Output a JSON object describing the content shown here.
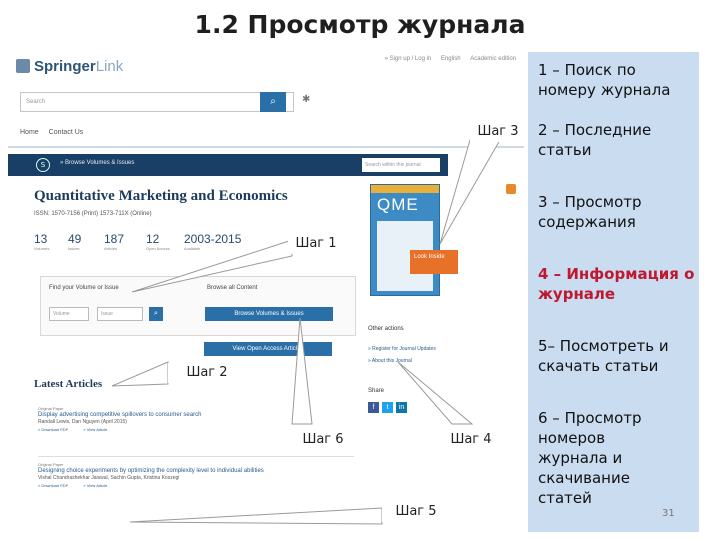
{
  "slide_title": "1.2 Просмотр журнала",
  "springer": {
    "logo_main": "Springer",
    "logo_link": "Link",
    "topnav": [
      "» Sign up / Log in",
      "English",
      "Academic edition"
    ],
    "search_placeholder": "Search",
    "search_icon": "magnifier-icon",
    "breadcrumbs": [
      "Home",
      "Contact Us"
    ],
    "browse_bar_text": "» Browse Volumes & Issues",
    "bar_search_placeholder": "Search within this journal",
    "journal_title": "Quantitative Marketing and Economics",
    "issn": "ISSN: 1570-7156 (Print) 1573-711X (Online)",
    "stats": [
      {
        "num": "13",
        "label": "Volumes"
      },
      {
        "num": "49",
        "label": "Issues"
      },
      {
        "num": "187",
        "label": "Articles"
      },
      {
        "num": "12",
        "label": "Open Access"
      },
      {
        "num": "2003-2015",
        "label": "Available"
      }
    ],
    "cover_text": "QME",
    "look_inside": "Look Inside",
    "find_label": "Find your Volume or Issue",
    "browse_label": "Browse all Content",
    "volume_placeholder": "Volume",
    "issue_placeholder": "Issue",
    "browse_button": "Browse Volumes & Issues",
    "open_access_button": "View Open Access Articles",
    "other_actions": "Other actions",
    "other_links": [
      "» Register for Journal Updates",
      "» About this Journal"
    ],
    "share": "Share",
    "latest_articles": "Latest Articles",
    "articles": [
      {
        "type": "Original Paper",
        "title": "Display advertising competitive spillovers to consumer search",
        "authors": "Randall Lewis, Dan Nguyen (April 2015)",
        "download": "» Download PDF",
        "view": "» View Article"
      },
      {
        "type": "Original Paper",
        "title": "Designing choice experiments by optimizing the complexity level to individual abilities",
        "authors": "Vishal Chandrashekhar Jaiswal, Sachin Gupta, Kristina Koszegi",
        "download": "» Download PDF",
        "view": "» View Article"
      }
    ]
  },
  "steps": {
    "s1": "Шаг 1",
    "s2": "Шаг 2",
    "s3": "Шаг 3",
    "s4": "Шаг 4",
    "s5": "Шаг 5",
    "s6": "Шаг 6"
  },
  "panel": {
    "items": [
      "1 – Поиск по номеру журнала",
      "2 – Последние статьи",
      "3 – Просмотр содержания",
      "4 – Информация о журнале",
      "5– Посмотреть и скачать статьи",
      "6 – Просмотр номеров журнала и скачивание статей"
    ],
    "page_number": "31"
  },
  "colors": {
    "panel_bg": "#c9dcf0",
    "highlight": "#c0182e",
    "springer_blue": "#1a3f66",
    "button_blue": "#2a6fa8"
  }
}
